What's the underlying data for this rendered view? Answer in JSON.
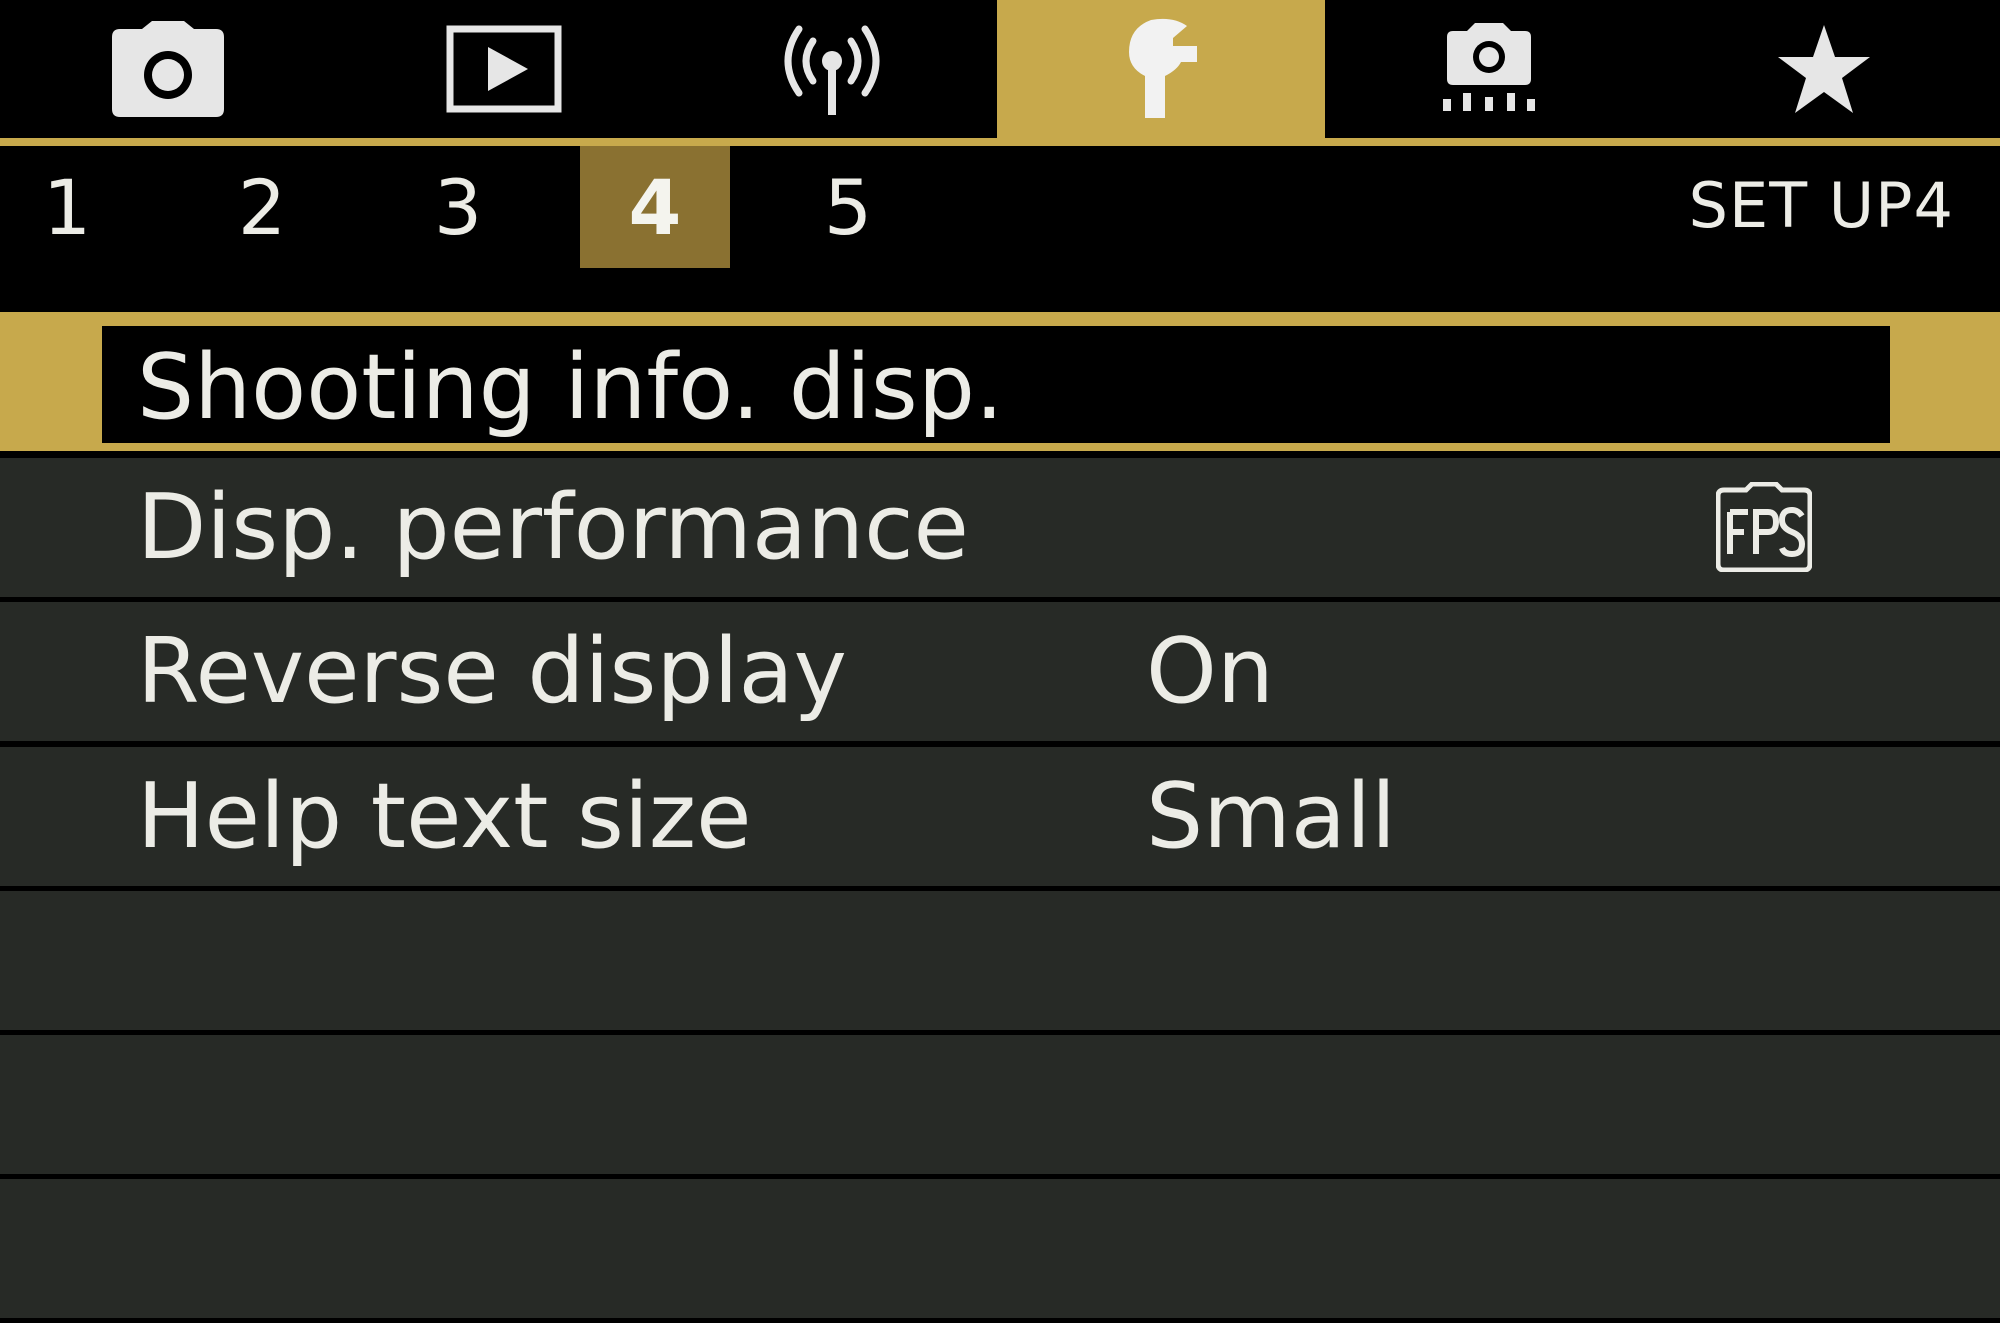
{
  "tabs": [
    {
      "icon": "camera-icon",
      "active": false
    },
    {
      "icon": "playback-icon",
      "active": false
    },
    {
      "icon": "wireless-icon",
      "active": false
    },
    {
      "icon": "wrench-icon",
      "active": true
    },
    {
      "icon": "custom-function-icon",
      "active": false
    },
    {
      "icon": "star-icon",
      "active": false
    }
  ],
  "pages": {
    "items": [
      "1",
      "2",
      "3",
      "4",
      "5"
    ],
    "active": "4"
  },
  "menu_title": "SET UP4",
  "menu": {
    "items": [
      {
        "label": "Shooting info. disp.",
        "value": "",
        "selected": true
      },
      {
        "label": "Disp. performance",
        "value": "",
        "icon": "fps-icon"
      },
      {
        "label": "Reverse display",
        "value": "On"
      },
      {
        "label": "Help text size",
        "value": "Small"
      }
    ],
    "empty_rows": 3
  },
  "colors": {
    "accent": "#c7a94c",
    "page_active": "#8a7131",
    "row_bg": "#272a26",
    "text": "#ecece6"
  }
}
